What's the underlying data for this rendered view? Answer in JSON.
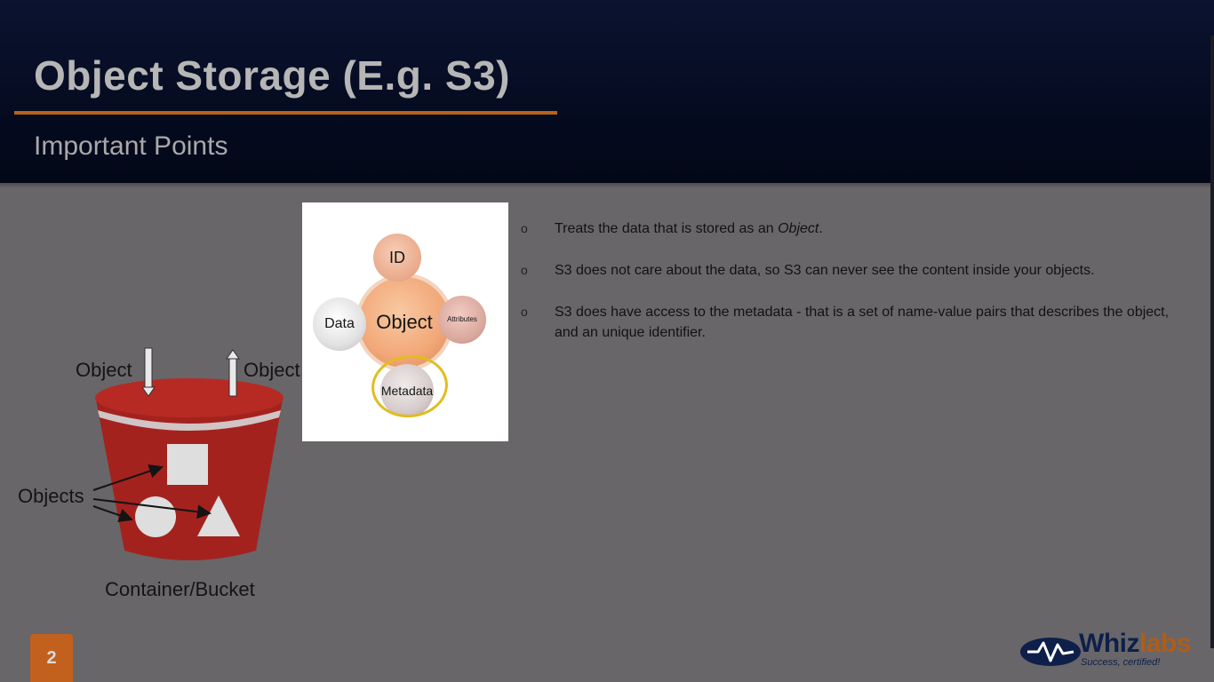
{
  "slide": {
    "title": "Object Storage (E.g. S3)",
    "subtitle": "Important Points",
    "page_number": "2"
  },
  "bucket": {
    "in_label": "Object",
    "out_label": "Object",
    "objects_label": "Objects",
    "caption": "Container/Bucket"
  },
  "object_diagram": {
    "center": "Object",
    "id": "ID",
    "data": "Data",
    "attributes": "Attributes",
    "metadata_line1": "Meta",
    "metadata_line2": "data"
  },
  "points": [
    {
      "bullet": "o",
      "text_before": "Treats the data that is stored as an ",
      "emphasis": "Object",
      "text_after": "."
    },
    {
      "bullet": "o",
      "text": "S3 does not care about the data, so S3 can never see the content inside your objects."
    },
    {
      "bullet": "o",
      "text": "S3 does have access to the metadata - that is a set of name-value pairs that describes the object, and an unique identifier."
    }
  ],
  "logo": {
    "brand_part1": "Whiz",
    "brand_part2": "labs",
    "tagline": "Success, certified!"
  },
  "colors": {
    "header_bg": "#050b20",
    "accent_orange": "#b8621c",
    "body_bg": "#686669",
    "bucket_red": "#a4221e",
    "highlight_ring": "#e1bd1e"
  }
}
